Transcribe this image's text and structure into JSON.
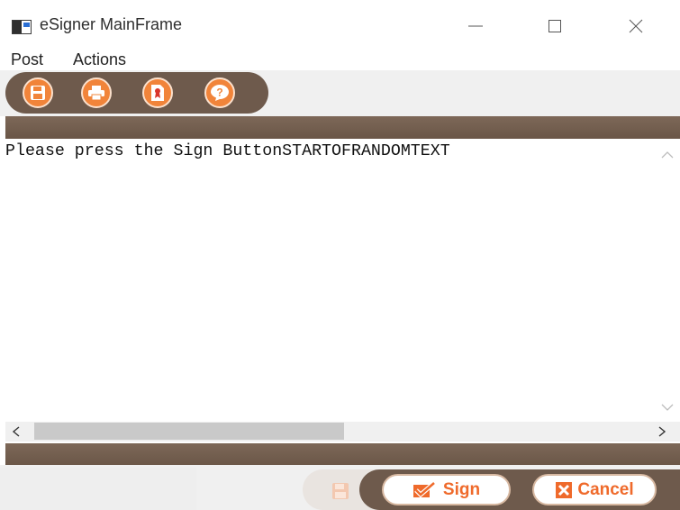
{
  "window": {
    "title": "eSigner MainFrame",
    "controls": [
      "minimize",
      "maximize",
      "close"
    ]
  },
  "menu": {
    "items": [
      {
        "label": "Post"
      },
      {
        "label": "Actions"
      }
    ]
  },
  "toolbar": {
    "buttons": [
      {
        "name": "save-button",
        "icon": "floppy-disk-icon"
      },
      {
        "name": "print-button",
        "icon": "printer-icon"
      },
      {
        "name": "certificate-button",
        "icon": "certificate-document-icon"
      },
      {
        "name": "help-button",
        "icon": "question-mark-icon"
      }
    ]
  },
  "content": {
    "message": "Please press the Sign ButtonSTARTOFRANDOMTEXT"
  },
  "actions": {
    "sign_label": "Sign",
    "cancel_label": "Cancel"
  },
  "colors": {
    "accent": "#ef6a2b",
    "toolbar_brown": "#6e5a4c",
    "strip_brown": "#77634f",
    "icon_orange": "#f1843a"
  }
}
